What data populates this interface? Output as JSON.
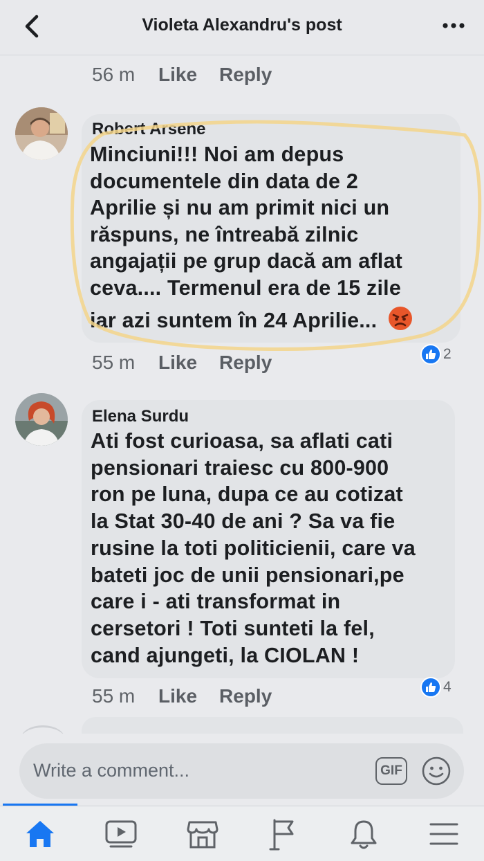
{
  "header": {
    "title": "Violeta Alexandru's post"
  },
  "top_meta": {
    "time": "56 m",
    "like": "Like",
    "reply": "Reply"
  },
  "comments": [
    {
      "author": "Robert Arsene",
      "lines": [
        "Minciuni!!! Noi am depus",
        "documentele din data de 2",
        "Aprilie și nu am primit nici un",
        "răspuns, ne întreabă zilnic",
        "angajații pe grup dacă am aflat",
        "ceva.... Termenul era de 15 zile",
        "iar azi suntem în 24 Aprilie..."
      ],
      "time": "55 m",
      "like": "Like",
      "reply": "Reply",
      "reaction_count": "2"
    },
    {
      "author": "Elena Surdu",
      "lines": [
        "Ati fost curioasa, sa aflati cati",
        "pensionari traiesc cu 800-900",
        "ron pe luna, dupa ce au cotizat",
        "la Stat 30-40 de ani ? Sa va fie",
        "rusine la toti politicienii, care va",
        "bateti joc de unii pensionari,pe",
        "care i - ati transformat in",
        "cersetori ! Toti sunteti la fel,",
        "cand ajungeti, la CIOLAN !"
      ],
      "time": "55 m",
      "like": "Like",
      "reply": "Reply",
      "reaction_count": "4"
    }
  ],
  "composer": {
    "placeholder": "Write a comment...",
    "gif_label": "GIF"
  },
  "tabbar": {
    "tabs": [
      "home-icon",
      "video-icon",
      "marketplace-icon",
      "pages-flag-icon",
      "notifications-bell-icon",
      "menu-icon"
    ]
  },
  "colors": {
    "accent": "#1877f2",
    "highlight_circle": "#f3d58a",
    "angry_emoji": "#e8562a"
  }
}
